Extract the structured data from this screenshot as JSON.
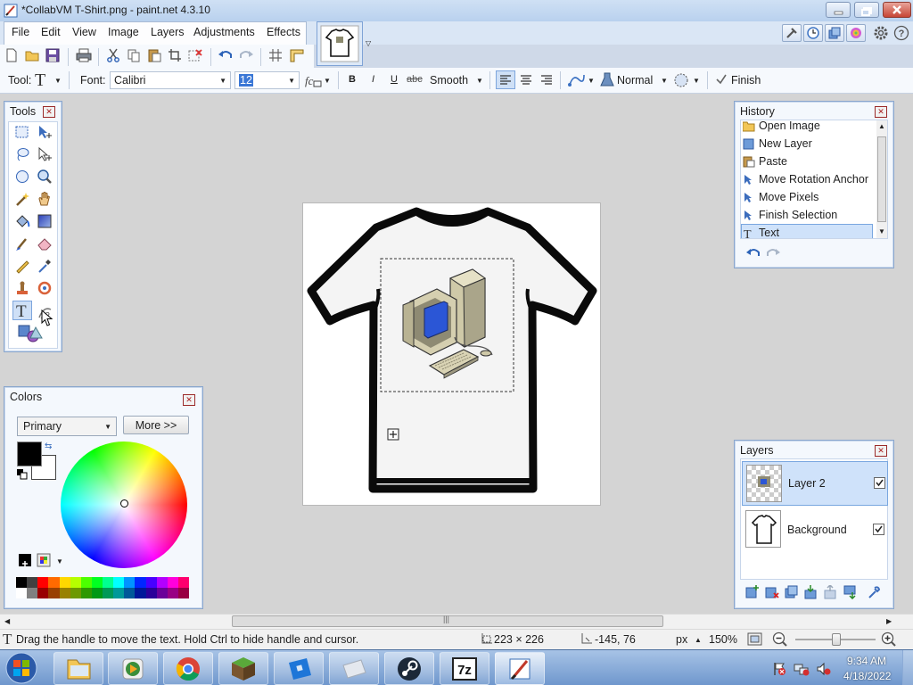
{
  "window": {
    "title": "*CollabVM T-Shirt.png - paint.net 4.3.10"
  },
  "menu": [
    "File",
    "Edit",
    "View",
    "Image",
    "Layers",
    "Adjustments",
    "Effects"
  ],
  "text_toolbar": {
    "tool_label": "Tool:",
    "font_label": "Font:",
    "font_value": "Calibri",
    "size_value": "12",
    "antialias_value": "Smooth",
    "blend_value": "Normal",
    "finish_label": "Finish",
    "bold": "B",
    "italic": "I",
    "underline": "U",
    "strike": "abc"
  },
  "panels": {
    "tools_title": "Tools",
    "colors_title": "Colors",
    "history_title": "History",
    "layers_title": "Layers"
  },
  "colors": {
    "mode_value": "Primary",
    "more_label": "More >>",
    "primary_color": "#000000",
    "secondary_color": "#ffffff",
    "palette": [
      "#000000",
      "#404040",
      "#ff0000",
      "#ff6a00",
      "#ffd800",
      "#b6ff00",
      "#4cff00",
      "#00ff21",
      "#00ff90",
      "#00ffff",
      "#0094ff",
      "#0026ff",
      "#4800ff",
      "#b200ff",
      "#ff00dc",
      "#ff006e"
    ]
  },
  "history": {
    "items": [
      {
        "label": "Open Image",
        "icon": "open-folder-icon"
      },
      {
        "label": "New Layer",
        "icon": "new-layer-icon"
      },
      {
        "label": "Paste",
        "icon": "paste-icon"
      },
      {
        "label": "Move Rotation Anchor",
        "icon": "move-selection-icon"
      },
      {
        "label": "Move Pixels",
        "icon": "move-selection-icon"
      },
      {
        "label": "Finish Selection",
        "icon": "move-selection-icon"
      },
      {
        "label": "Text",
        "icon": "text-tool-icon"
      }
    ]
  },
  "layers": {
    "items": [
      {
        "label": "Layer 2",
        "visible": true,
        "selected": true
      },
      {
        "label": "Background",
        "visible": true,
        "selected": false
      }
    ]
  },
  "status": {
    "hint": "Drag the handle to move the text. Hold Ctrl to hide handle and cursor.",
    "size": "223 × 226",
    "position": "-145, 76",
    "unit": "px",
    "zoom": "150%"
  },
  "clock": {
    "time": "9:34 AM",
    "date": "4/18/2022"
  },
  "taskbar": [
    "explorer",
    "media-center",
    "chrome",
    "minecraft",
    "roblox",
    "app",
    "steam",
    "7-zip",
    "paint.net"
  ]
}
